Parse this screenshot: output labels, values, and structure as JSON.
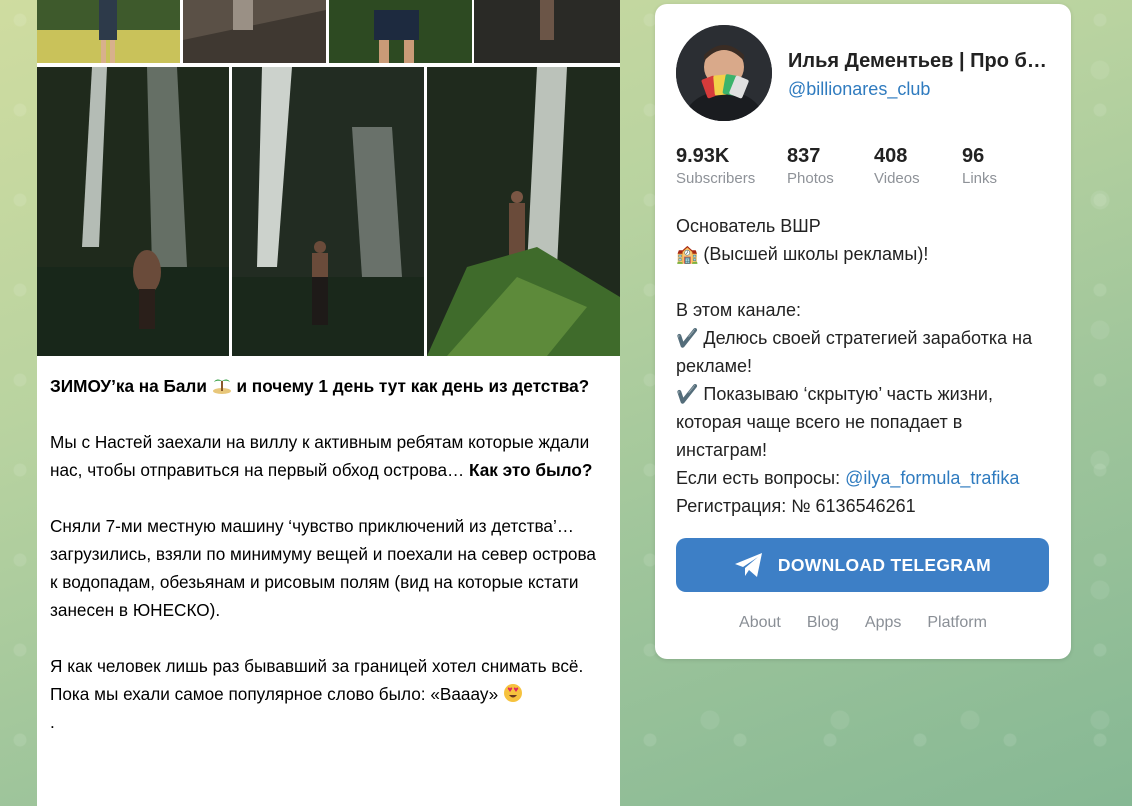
{
  "post": {
    "title_bold": "ЗИМОУ’ка на Бали",
    "title_rest": "и почему 1 день тут как день из детства?",
    "title_emoji": "island-emoji",
    "p2_text": "Мы с Настей заехали на виллу к активным ребятам которые ждали нас, чтобы отправиться на первый обход острова…",
    "p2_bold": "Как это было?",
    "p3_text": "Сняли 7-ми местную машину ‘чувство приключений из детства’… загрузились, взяли по минимуму вещей и поехали на север острова к водопадам, обезьянам и рисовым полям (вид на которые кстати занесен в ЮНЕСКО).",
    "p4_text": "Я как человек лишь раз бывавший за границей хотел снимать всё. Пока мы ехали самое популярное слово было: «Вааау»",
    "p4_emoji": "heart-eyes-emoji",
    "p4_tail": "."
  },
  "channel": {
    "title": "Илья Дементьев | Про бизнес",
    "username": "@billionares_club",
    "stats": [
      {
        "value": "9.93K",
        "label": "Subscribers"
      },
      {
        "value": "837",
        "label": "Photos"
      },
      {
        "value": "408",
        "label": "Videos"
      },
      {
        "value": "96",
        "label": "Links"
      }
    ],
    "description": {
      "line1": "Основатель ВШР",
      "line2": "🏫 (Высшей школы рекламы)!",
      "line3": "В этом канале:",
      "line4": "✔️ Делюсь своей стратегией заработка на рекламе!",
      "line5": "✔️ Показываю ‘скрытую’ часть жизни, которая чаще всего не попадает в инстаграм!",
      "line6_prefix": "Если есть вопросы: ",
      "line6_link": "@ilya_formula_trafika",
      "line7": "Регистрация: № 6136546261"
    },
    "download_label": "DOWNLOAD TELEGRAM",
    "footer_links": [
      "About",
      "Blog",
      "Apps",
      "Platform"
    ]
  },
  "colors": {
    "accent": "#3d7fc6",
    "link": "#2f7bbf",
    "muted": "#8e9298"
  }
}
